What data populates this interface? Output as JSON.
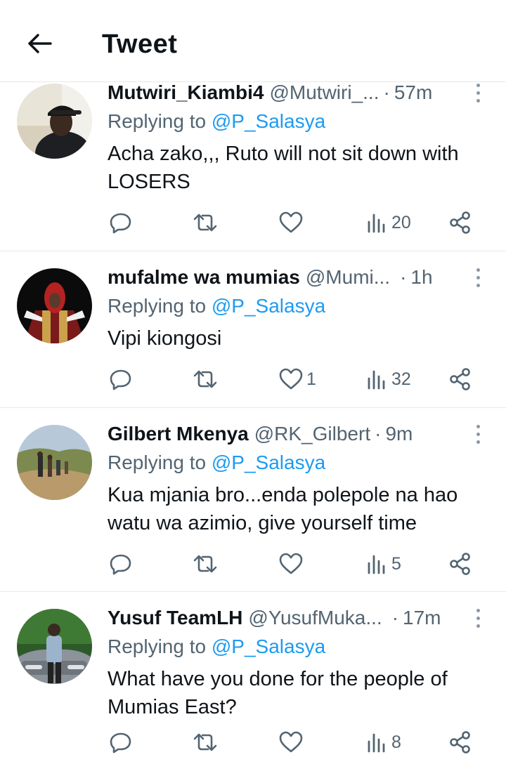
{
  "header": {
    "title": "Tweet"
  },
  "replies": [
    {
      "name": "Mutwiri_Kiambi4",
      "handle": "@Mutwiri_...",
      "dot": "·",
      "time": "57m",
      "replying_prefix": "Replying to",
      "replying_to": "@P_Salasya",
      "text": "Acha zako,,, Ruto will not sit down with LOSERS",
      "likes": "",
      "views": "20"
    },
    {
      "name": "mufalme wa mumias",
      "handle": "@Mumi...",
      "dot": "·",
      "time": "1h",
      "replying_prefix": "Replying to",
      "replying_to": "@P_Salasya",
      "text": "Vipi kiongosi",
      "likes": "1",
      "views": "32"
    },
    {
      "name": "Gilbert Mkenya",
      "handle": "@RK_Gilbert",
      "dot": "·",
      "time": "9m",
      "replying_prefix": "Replying to",
      "replying_to": "@P_Salasya",
      "text": "Kua mjania bro...enda polepole na hao watu wa azimio, give yourself time",
      "likes": "",
      "views": "5"
    },
    {
      "name": "Yusuf TeamLH",
      "handle": "@YusufMuka...",
      "dot": "·",
      "time": "17m",
      "replying_prefix": "Replying to",
      "replying_to": "@P_Salasya",
      "text": "What have you done for the people of Mumias East?",
      "likes": "",
      "views": "8"
    }
  ],
  "icons": {
    "back": "arrow-left-icon",
    "more": "more-vertical-icon",
    "reply": "reply-icon",
    "retweet": "retweet-icon",
    "like": "heart-icon",
    "views": "views-icon",
    "share": "share-icon"
  },
  "colors": {
    "text": "#0f1419",
    "secondary": "#536471",
    "link": "#1d9bf0",
    "divider": "#e7e9ea"
  }
}
